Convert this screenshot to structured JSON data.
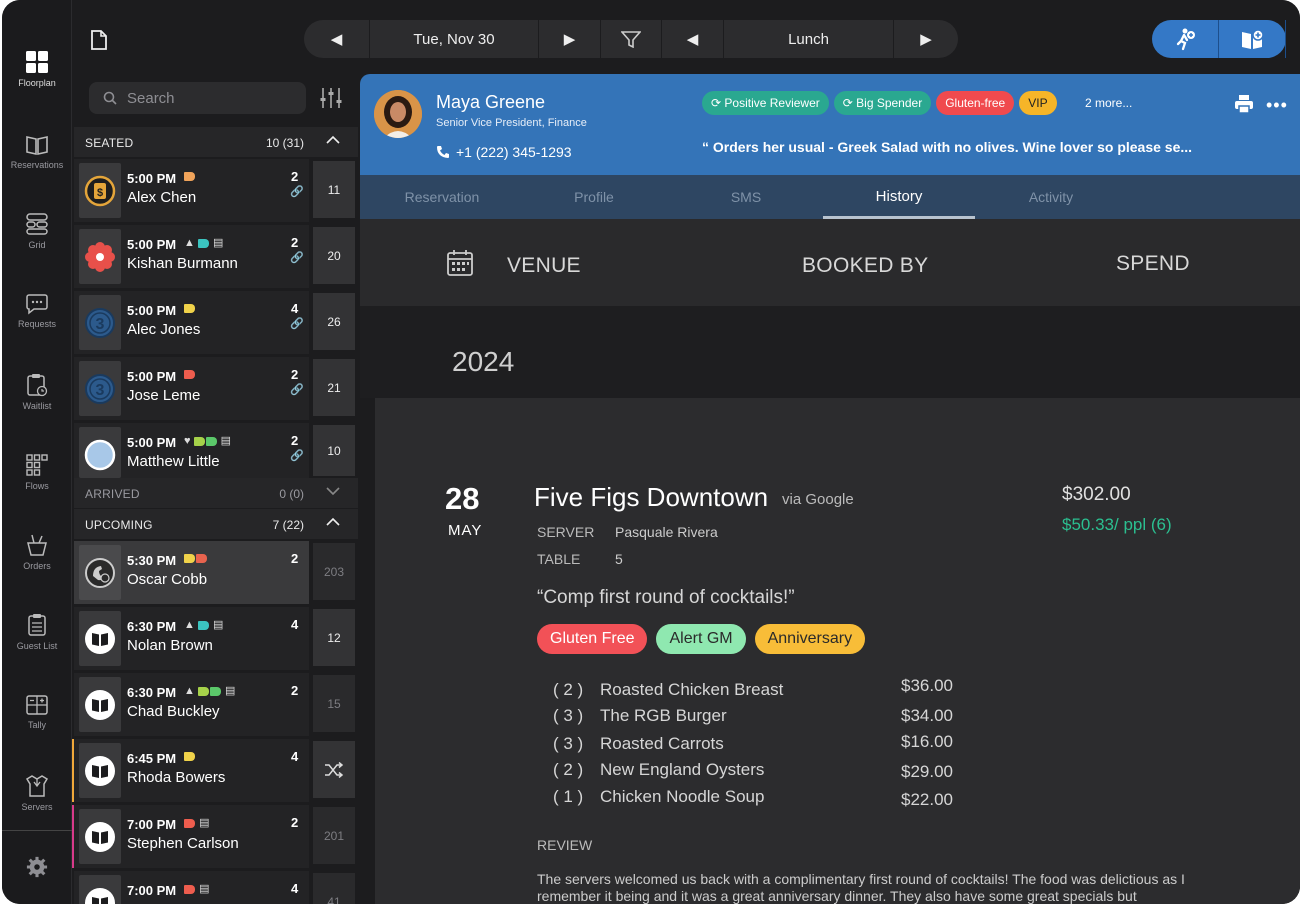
{
  "nav": {
    "items": [
      {
        "label": "Floorplan",
        "icon": "floorplan-icon"
      },
      {
        "label": "Reservations",
        "icon": "book-icon"
      },
      {
        "label": "Grid",
        "icon": "grid-icon"
      },
      {
        "label": "Requests",
        "icon": "chat-icon"
      },
      {
        "label": "Waitlist",
        "icon": "clipboard-icon"
      },
      {
        "label": "Flows",
        "icon": "flows-icon"
      },
      {
        "label": "Orders",
        "icon": "orders-icon"
      },
      {
        "label": "Guest List",
        "icon": "list-icon"
      },
      {
        "label": "Tally",
        "icon": "tally-icon"
      },
      {
        "label": "Servers",
        "icon": "servers-icon"
      }
    ]
  },
  "topbar": {
    "date": "Tue, Nov 30",
    "shift": "Lunch"
  },
  "search": {
    "placeholder": "Search"
  },
  "sections": {
    "seated": {
      "label": "SEATED",
      "count": "10 (31)"
    },
    "arrived": {
      "label": "ARRIVED",
      "count": "0 (0)"
    },
    "upcoming": {
      "label": "UPCOMING",
      "count": "7 (22)"
    }
  },
  "seated": [
    {
      "time": "5:00 PM",
      "name": "Alex Chen",
      "party": "2",
      "table": "11"
    },
    {
      "time": "5:00 PM",
      "name": "Kishan Burmann",
      "party": "2",
      "table": "20"
    },
    {
      "time": "5:00 PM",
      "name": "Alec Jones",
      "party": "4",
      "table": "26"
    },
    {
      "time": "5:00 PM",
      "name": "Jose Leme",
      "party": "2",
      "table": "21"
    },
    {
      "time": "5:00 PM",
      "name": "Matthew Little",
      "party": "2",
      "table": "10"
    }
  ],
  "upcoming": [
    {
      "time": "5:30 PM",
      "name": "Oscar Cobb",
      "party": "2",
      "table": "203"
    },
    {
      "time": "6:30 PM",
      "name": "Nolan Brown",
      "party": "4",
      "table": "12"
    },
    {
      "time": "6:30 PM",
      "name": "Chad Buckley",
      "party": "2",
      "table": "15"
    },
    {
      "time": "6:45 PM",
      "name": "Rhoda Bowers",
      "party": "4",
      "table": ""
    },
    {
      "time": "7:00 PM",
      "name": "Stephen Carlson",
      "party": "2",
      "table": "201"
    },
    {
      "time": "7:00 PM",
      "name": "",
      "party": "4",
      "table": "41"
    }
  ],
  "guest": {
    "name": "Maya Greene",
    "title": "Senior Vice President, Finance",
    "phone": "+1 (222) 345-1293",
    "tags": [
      {
        "label": "Positive Reviewer",
        "color": "#2aa890"
      },
      {
        "label": "Big Spender",
        "color": "#2aa890"
      },
      {
        "label": "Gluten-free",
        "color": "#f04a4e"
      },
      {
        "label": "VIP",
        "color": "#f6b528"
      }
    ],
    "more": "2 more...",
    "quote": "“ Orders her usual - Greek Salad with no olives. Wine lover so please se..."
  },
  "tabs": [
    "Reservation",
    "Profile",
    "SMS",
    "History",
    "Activity"
  ],
  "history": {
    "columns": {
      "venue": "VENUE",
      "booked_by": "BOOKED BY",
      "spend": "SPEND"
    },
    "year": "2024",
    "visit": {
      "day": "28",
      "month": "MAY",
      "venue": "Five Figs Downtown",
      "via": "via Google",
      "server_label": "SERVER",
      "server": "Pasquale Rivera",
      "table_label": "TABLE",
      "table": "5",
      "spend": "$302.00",
      "per_person": "$50.33/ ppl (6)",
      "note": "“Comp first round of cocktails!”",
      "tags": [
        {
          "label": "Gluten Free",
          "color": "#f25157"
        },
        {
          "label": "Alert GM",
          "color": "#8fe8b0"
        },
        {
          "label": "Anniversary",
          "color": "#f8bd38"
        }
      ],
      "items": [
        {
          "qty": "( 2 )",
          "name": "Roasted Chicken Breast",
          "price": "$36.00"
        },
        {
          "qty": "( 3 )",
          "name": "The RGB Burger",
          "price": "$34.00"
        },
        {
          "qty": "( 3 )",
          "name": "Roasted Carrots",
          "price": "$16.00"
        },
        {
          "qty": "( 2 )",
          "name": "New England Oysters",
          "price": "$29.00"
        },
        {
          "qty": "( 1 )",
          "name": "Chicken Noodle Soup",
          "price": "$22.00"
        }
      ],
      "review_label": "REVIEW",
      "review": "The servers welcomed us back with a complimentary first round of cocktails! The food was delictious as I remember it being and it was a great anniversary dinner. They also have some great specials but"
    }
  },
  "colors": {
    "accent": "#3474b8",
    "background": "#1c1c1e",
    "positive": "#2bbf90"
  }
}
